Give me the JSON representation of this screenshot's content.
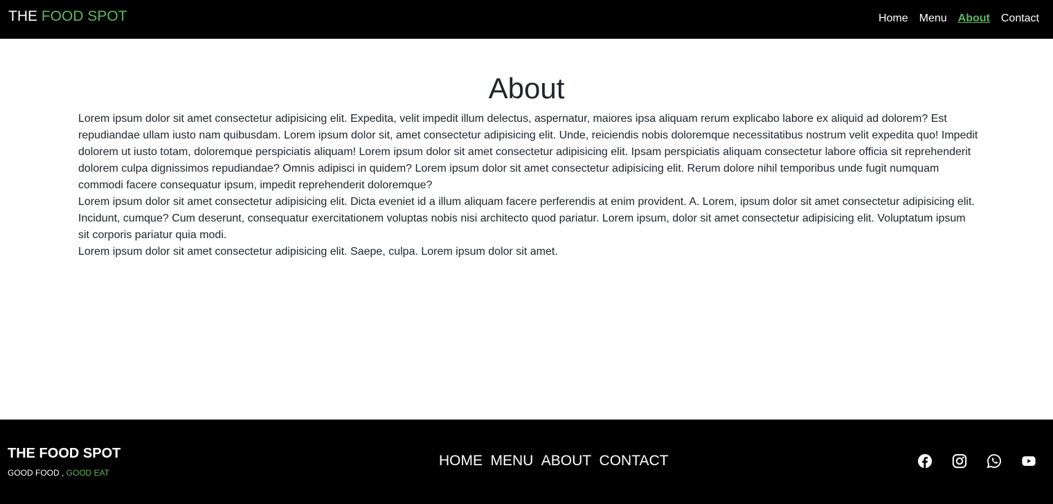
{
  "header": {
    "brand_part1": "THE ",
    "brand_part2": "FOOD SPOT",
    "nav": [
      {
        "label": "Home"
      },
      {
        "label": "Menu"
      },
      {
        "label": "About"
      },
      {
        "label": "Contact"
      }
    ]
  },
  "main": {
    "title": "About",
    "paragraphs": [
      "Lorem ipsum dolor sit amet consectetur adipisicing elit. Expedita, velit impedit illum delectus, aspernatur, maiores ipsa aliquam rerum explicabo labore ex aliquid ad dolorem? Est repudiandae ullam iusto nam quibusdam. Lorem ipsum dolor sit, amet consectetur adipisicing elit. Unde, reiciendis nobis doloremque necessitatibus nostrum velit expedita quo! Impedit dolorem ut iusto totam, doloremque perspiciatis aliquam! Lorem ipsum dolor sit amet consectetur adipisicing elit. Ipsam perspiciatis aliquam consectetur labore officia sit reprehenderit dolorem culpa dignissimos repudiandae? Omnis adipisci in quidem? Lorem ipsum dolor sit amet consectetur adipisicing elit. Rerum dolore nihil temporibus unde fugit numquam commodi facere consequatur ipsum, impedit reprehenderit doloremque?",
      "Lorem ipsum dolor sit amet consectetur adipisicing elit. Dicta eveniet id a illum aliquam facere perferendis at enim provident. A. Lorem, ipsum dolor sit amet consectetur adipisicing elit. Incidunt, cumque? Cum deserunt, consequatur exercitationem voluptas nobis nisi architecto quod pariatur. Lorem ipsum, dolor sit amet consectetur adipisicing elit. Voluptatum ipsum sit corporis pariatur quia modi.",
      "Lorem ipsum dolor sit amet consectetur adipisicing elit. Saepe, culpa. Lorem ipsum dolor sit amet."
    ]
  },
  "footer": {
    "brand": "THE FOOD SPOT",
    "tagline_part1": "GOOD FOOD , ",
    "tagline_part2": "GOOD EAT",
    "nav": [
      {
        "label": "HOME"
      },
      {
        "label": "MENU"
      },
      {
        "label": "ABOUT"
      },
      {
        "label": "CONTACT"
      }
    ],
    "socials": [
      "facebook-icon",
      "instagram-icon",
      "whatsapp-icon",
      "youtube-icon"
    ]
  },
  "colors": {
    "accent": "#5cb85c",
    "bar_background": "#000000",
    "text": "#212529"
  }
}
